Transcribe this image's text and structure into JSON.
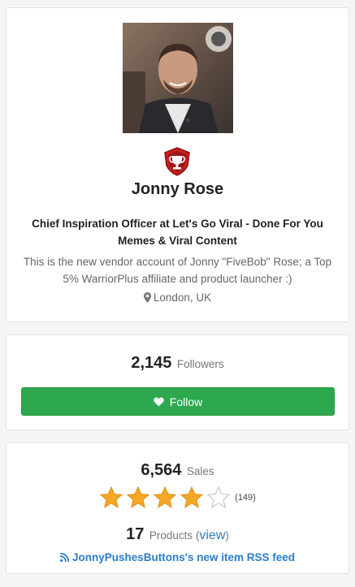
{
  "profile": {
    "name": "Jonny Rose",
    "headline": "Chief Inspiration Officer at Let's Go Viral - Done For You Memes & Viral Content",
    "bio": "This is the new vendor account of Jonny \"FiveBob\" Rose; a Top 5% WarriorPlus affiliate and product launcher :)",
    "location": "London, UK",
    "badge_icon": "trophy-shield-icon"
  },
  "followers": {
    "count": "2,145",
    "label": "Followers",
    "button_label": "Follow",
    "button_color": "#2ea84f"
  },
  "sales": {
    "count": "6,564",
    "label": "Sales",
    "rating": 4,
    "rating_max": 5,
    "rating_count": "(149)",
    "products_count": "17",
    "products_label": "Products (",
    "view_label": "view",
    "products_close": ")",
    "rss_label": "JonnyPushesButtons's new item RSS feed"
  },
  "colors": {
    "link": "#2a7ec7",
    "star": "#f5a623",
    "badge": "#c62020"
  }
}
